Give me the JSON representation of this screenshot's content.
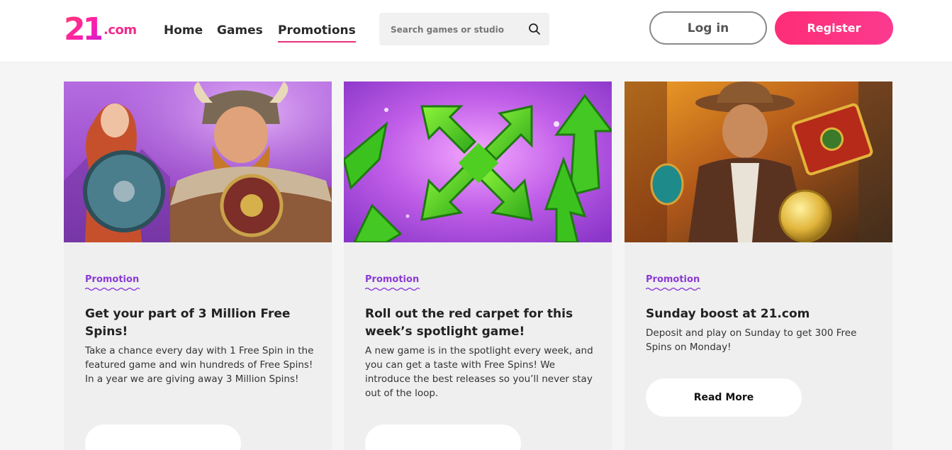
{
  "header": {
    "logo_number": "21",
    "logo_domain": ".com",
    "nav": [
      {
        "label": "Home"
      },
      {
        "label": "Games"
      },
      {
        "label": "Promotions"
      }
    ],
    "search": {
      "placeholder": "Search games or studio",
      "value": "",
      "icon": "search-icon"
    },
    "login_label": "Log in",
    "register_label": "Register"
  },
  "colors": {
    "accent_pink": "#ff2d76",
    "promo_purple": "#8a3ad6",
    "card_bg": "#efefef"
  },
  "cards": [
    {
      "image": "viking-warriors",
      "tag": "Promotion",
      "title": "Get your part of 3 Million Free Spins!",
      "description": "Take a chance every day with 1 Free Spin in the featured game and win hundreds of Free Spins! In a year we are giving away 3 Million Spins!",
      "button": ""
    },
    {
      "image": "green-arrows",
      "tag": "Promotion",
      "title": "Roll out the red carpet for this week’s spotlight game!",
      "description": "A new game is in the spotlight every week, and you can get a taste with Free Spins! We introduce the best releases so you’ll never stay out of the loop.",
      "button": ""
    },
    {
      "image": "explorer-adventurer",
      "tag": "Promotion",
      "title": "Sunday boost at 21.com",
      "description": "Deposit and play on Sunday to get 300 Free Spins on Monday!",
      "button": "Read More"
    }
  ]
}
